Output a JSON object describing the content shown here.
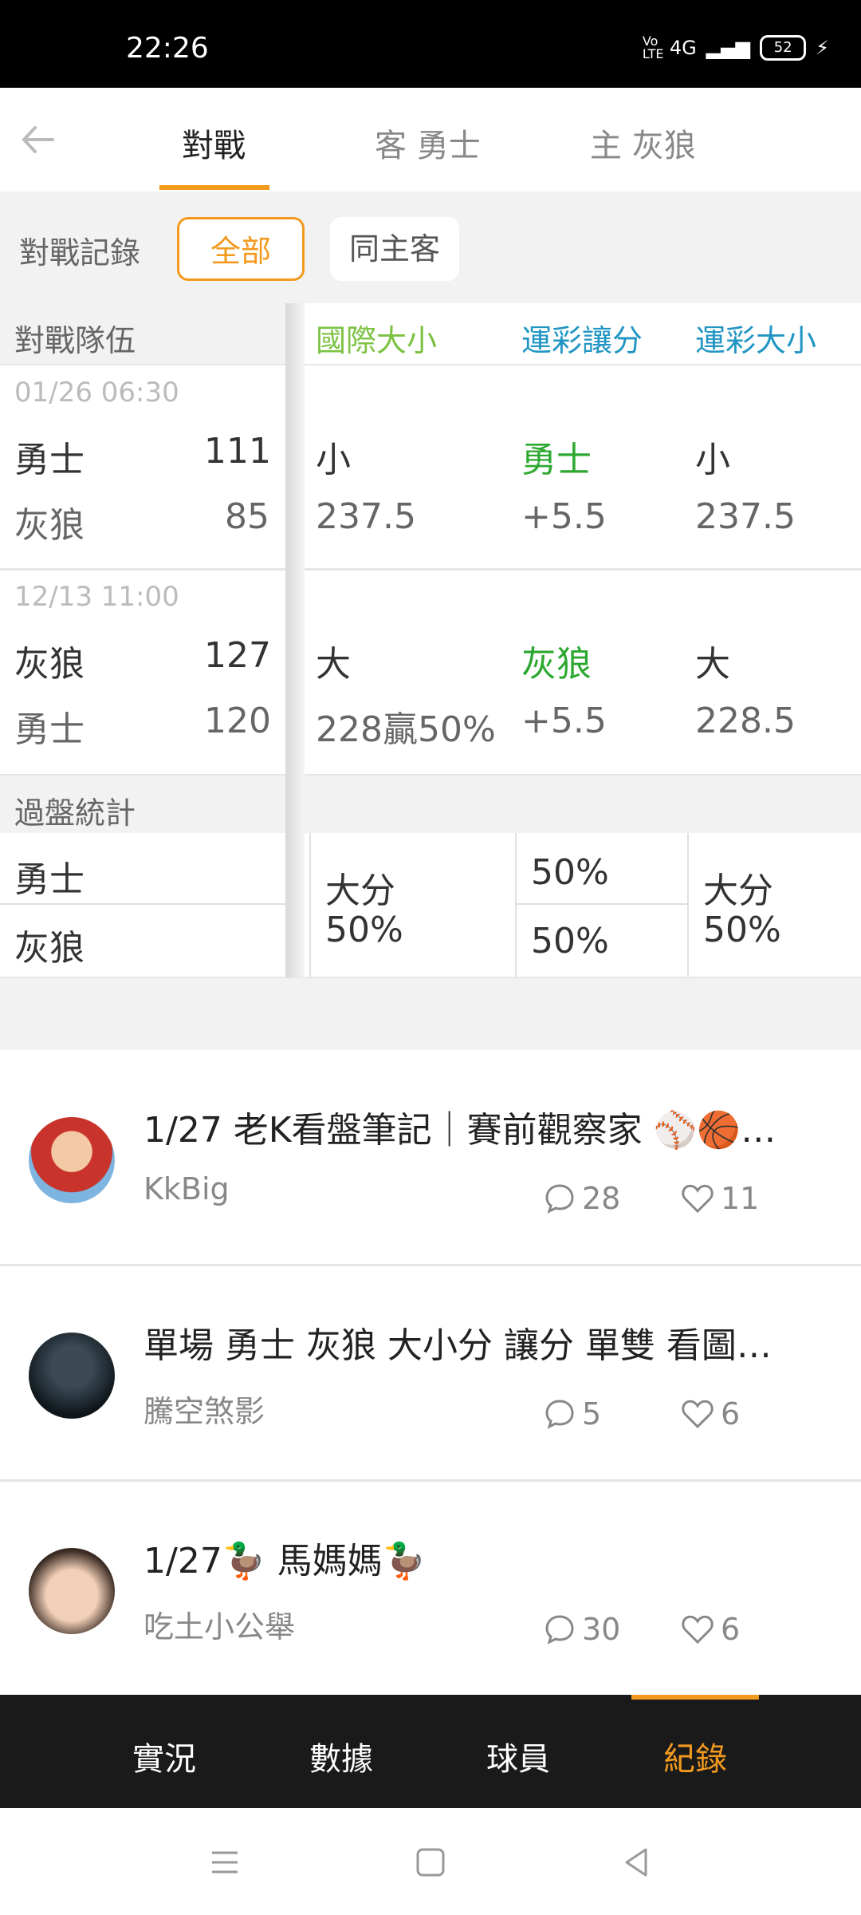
{
  "status": {
    "time": "22:26",
    "network": "4G",
    "volte": "Vo LTE",
    "battery": "52"
  },
  "tabs": [
    {
      "label": "對戰",
      "active": true
    },
    {
      "label": "客 勇士",
      "active": false
    },
    {
      "label": "主 灰狼",
      "active": false
    }
  ],
  "filter": {
    "label": "對戰記錄",
    "chips": [
      "全部",
      "同主客"
    ],
    "selected": "全部"
  },
  "table": {
    "headers": [
      "對戰隊伍",
      "國際大小",
      "運彩讓分",
      "運彩大小"
    ],
    "games": [
      {
        "date": "01/26 06:30",
        "team1": "勇士",
        "score1": "111",
        "team2": "灰狼",
        "score2": "85",
        "intl": [
          "小",
          "237.5"
        ],
        "spread": [
          "勇士",
          "+5.5"
        ],
        "total": [
          "小",
          "237.5"
        ]
      },
      {
        "date": "12/13 11:00",
        "team1": "灰狼",
        "score1": "127",
        "team2": "勇士",
        "score2": "120",
        "intl": [
          "大",
          "228贏50%"
        ],
        "spread": [
          "灰狼",
          "+5.5"
        ],
        "total": [
          "大",
          "228.5"
        ]
      }
    ],
    "stats": {
      "label": "過盤統計",
      "teams": [
        "勇士",
        "灰狼"
      ],
      "intl": [
        "大分",
        "50%"
      ],
      "spread": [
        "50%",
        "50%"
      ],
      "total": [
        "大分",
        "50%"
      ]
    }
  },
  "posts": [
    {
      "title": "1/27 老K看盤筆記｜賽前觀察家 ⚾🏀…",
      "author": "KkBig",
      "comments": "28",
      "likes": "11"
    },
    {
      "title": "單場 勇士 灰狼 大小分 讓分 單雙 看圖…",
      "author": "騰空煞影",
      "comments": "5",
      "likes": "6"
    },
    {
      "title": "1/27🦆 馬媽媽🦆",
      "author": "吃土小公舉",
      "comments": "30",
      "likes": "6"
    }
  ],
  "bottom_nav": [
    {
      "label": "實況",
      "active": false
    },
    {
      "label": "數據",
      "active": false
    },
    {
      "label": "球員",
      "active": false
    },
    {
      "label": "紀錄",
      "active": true
    }
  ],
  "colors": {
    "accent": "#f39a1e",
    "green": "#2ca830",
    "blue": "#2196c4"
  }
}
